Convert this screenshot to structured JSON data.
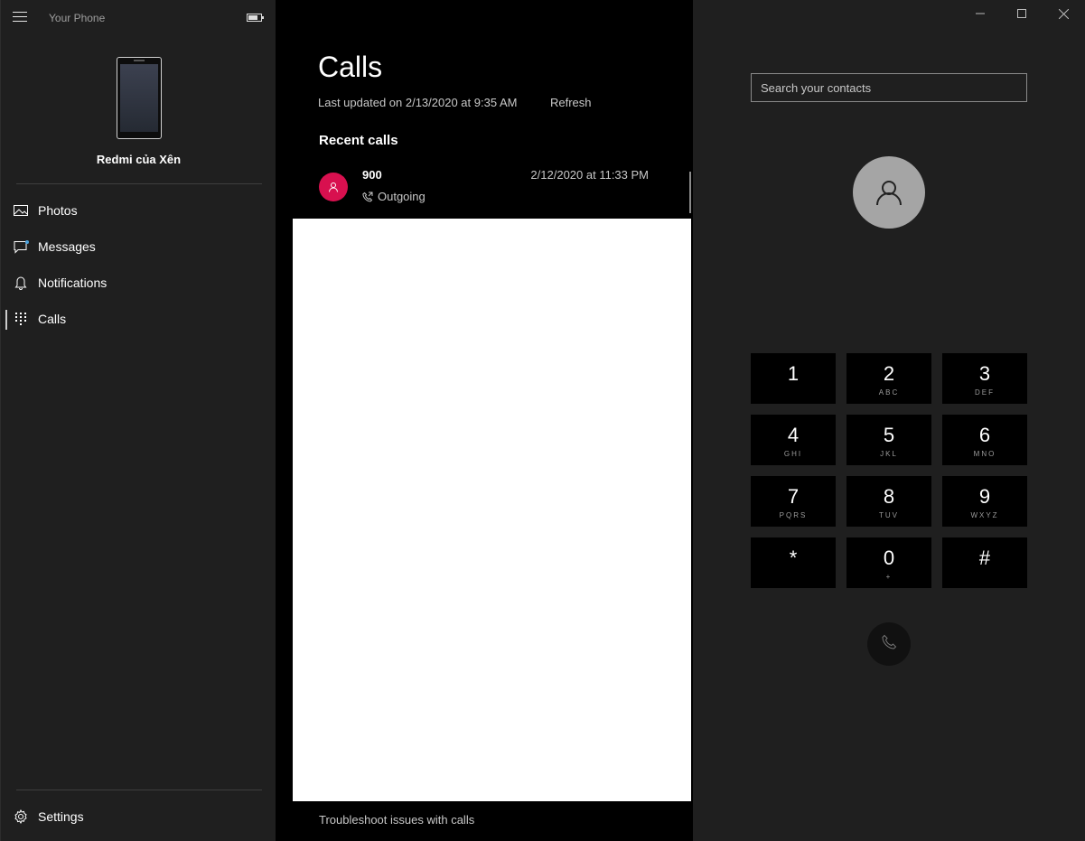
{
  "window": {
    "title": "Your Phone",
    "controls": [
      "minimize-icon",
      "maximize-icon",
      "close-icon"
    ]
  },
  "sidebar": {
    "device_name": "Redmi của Xên",
    "items": [
      {
        "label": "Photos",
        "icon": "photos-icon"
      },
      {
        "label": "Messages",
        "icon": "messages-icon"
      },
      {
        "label": "Notifications",
        "icon": "notifications-icon"
      },
      {
        "label": "Calls",
        "icon": "dialpad-icon",
        "active": true
      }
    ],
    "settings_label": "Settings"
  },
  "calls": {
    "title": "Calls",
    "last_updated": "Last updated on 2/13/2020 at 9:35 AM",
    "refresh_label": "Refresh",
    "recent_label": "Recent calls",
    "recent": [
      {
        "number": "900",
        "type": "Outgoing",
        "datetime": "2/12/2020 at 11:33 PM",
        "avatar_color": "#d8104f"
      }
    ],
    "troubleshoot_label": "Troubleshoot issues with calls"
  },
  "dialer": {
    "search_placeholder": "Search your contacts",
    "keys": [
      {
        "digit": "1",
        "letters": ""
      },
      {
        "digit": "2",
        "letters": "ABC"
      },
      {
        "digit": "3",
        "letters": "DEF"
      },
      {
        "digit": "4",
        "letters": "GHI"
      },
      {
        "digit": "5",
        "letters": "JKL"
      },
      {
        "digit": "6",
        "letters": "MNO"
      },
      {
        "digit": "7",
        "letters": "PQRS"
      },
      {
        "digit": "8",
        "letters": "TUV"
      },
      {
        "digit": "9",
        "letters": "WXYZ"
      },
      {
        "digit": "*",
        "letters": ""
      },
      {
        "digit": "0",
        "letters": "+"
      },
      {
        "digit": "#",
        "letters": ""
      }
    ]
  },
  "colors": {
    "sidebar_bg": "#1f1f1f",
    "content_bg": "#000000",
    "accent_avatar": "#d8104f",
    "contact_avatar": "#a5a5a5"
  }
}
